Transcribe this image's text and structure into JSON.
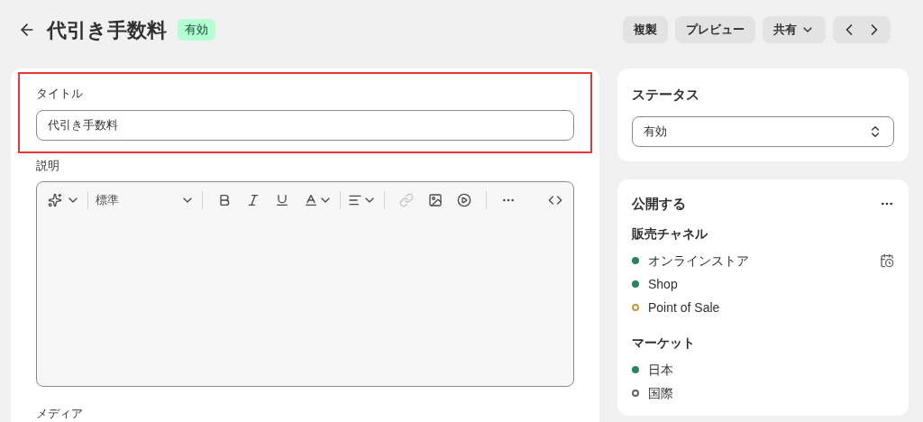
{
  "header": {
    "title": "代引き手数料",
    "status_badge": "有効",
    "actions": [
      "複製",
      "プレビュー",
      "共有"
    ]
  },
  "main": {
    "title_field": {
      "label": "タイトル",
      "value": "代引き手数料",
      "highlighted": true
    },
    "description": {
      "label": "説明",
      "format_select": "標準"
    },
    "media_label": "メディア"
  },
  "status_card": {
    "title": "ステータス",
    "value": "有効"
  },
  "publish_card": {
    "title": "公開する",
    "sections": [
      {
        "heading": "販売チャネル",
        "items": [
          {
            "label": "オンラインストア",
            "active": true,
            "color": "#29845a",
            "scheduled": true
          },
          {
            "label": "Shop",
            "active": true,
            "color": "#29845a",
            "scheduled": false
          },
          {
            "label": "Point of Sale",
            "active": false,
            "color": "#c9973a",
            "scheduled": false
          }
        ]
      },
      {
        "heading": "マーケット",
        "items": [
          {
            "label": "日本",
            "active": true,
            "color": "#29845a",
            "scheduled": false
          },
          {
            "label": "国際",
            "active": false,
            "color": "#616161",
            "scheduled": false
          }
        ]
      }
    ]
  }
}
